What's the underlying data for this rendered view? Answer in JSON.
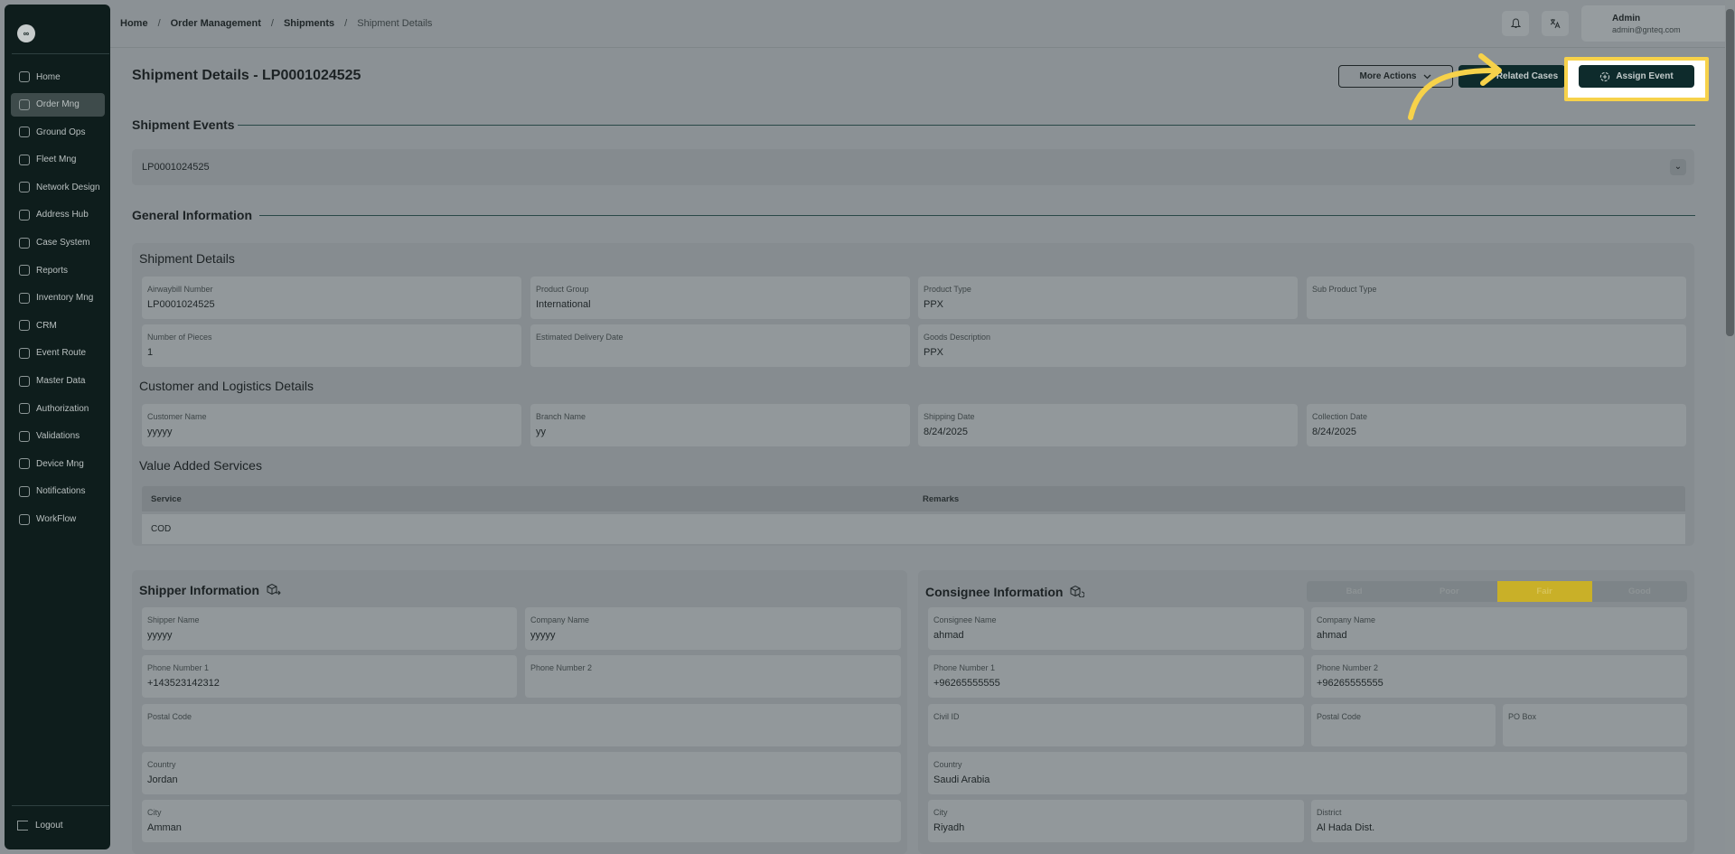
{
  "sidebar": {
    "logo": "∞",
    "items": [
      {
        "label": "Home"
      },
      {
        "label": "Order Mng"
      },
      {
        "label": "Ground Ops"
      },
      {
        "label": "Fleet Mng"
      },
      {
        "label": "Network Design"
      },
      {
        "label": "Address Hub"
      },
      {
        "label": "Case System"
      },
      {
        "label": "Reports"
      },
      {
        "label": "Inventory Mng"
      },
      {
        "label": "CRM"
      },
      {
        "label": "Event Route"
      },
      {
        "label": "Master Data"
      },
      {
        "label": "Authorization"
      },
      {
        "label": "Validations"
      },
      {
        "label": "Device Mng"
      },
      {
        "label": "Notifications"
      },
      {
        "label": "WorkFlow"
      }
    ],
    "active": "Order Mng",
    "logout": "Logout"
  },
  "breadcrumb": {
    "b0": "Home",
    "b1": "Order Management",
    "b2": "Shipments",
    "b3": "Shipment Details",
    "sep": "/"
  },
  "user": {
    "name": "Admin",
    "email": "admin@gnteq.com"
  },
  "header": {
    "title": "Shipment Details - LP0001024525",
    "more_actions": "More Actions",
    "related_cases": "Related Cases",
    "assign_event": "Assign Event",
    "highlight_color": "#f7d24a"
  },
  "events": {
    "title": "Shipment Events",
    "value": "LP0001024525"
  },
  "general": {
    "title": "General Information",
    "shipment_details": {
      "title": "Shipment Details",
      "airwaybill_label": "Airwaybill Number",
      "airwaybill": "LP0001024525",
      "product_group_label": "Product Group",
      "product_group": "International",
      "product_type_label": "Product Type",
      "product_type": "PPX",
      "sub_product_label": "Sub Product Type",
      "sub_product": "",
      "pieces_label": "Number of Pieces",
      "pieces": "1",
      "edd_label": "Estimated Delivery Date",
      "edd": "",
      "goods_label": "Goods Description",
      "goods": "PPX"
    },
    "customer": {
      "title": "Customer and Logistics Details",
      "name_label": "Customer Name",
      "name": "yyyyy",
      "branch_label": "Branch Name",
      "branch": "yy",
      "shipping_label": "Shipping Date",
      "shipping": "8/24/2025",
      "collection_label": "Collection Date",
      "collection": "8/24/2025"
    },
    "vas": {
      "title": "Value Added Services",
      "col_service": "Service",
      "col_remarks": "Remarks",
      "rows": [
        {
          "service": "COD",
          "remarks": ""
        }
      ]
    }
  },
  "shipper": {
    "title": "Shipper Information",
    "name_label": "Shipper Name",
    "name": "yyyyy",
    "company_label": "Company Name",
    "company": "yyyyy",
    "phone1_label": "Phone Number 1",
    "phone1": "+143523142312",
    "phone2_label": "Phone Number 2",
    "phone2": "",
    "postal_label": "Postal Code",
    "postal": "",
    "country_label": "Country",
    "country": "Jordan",
    "city_label": "City",
    "city": "Amman"
  },
  "consignee": {
    "title": "Consignee Information",
    "rating": [
      "Bad",
      "Poor",
      "Fair",
      "Good"
    ],
    "rating_selected": "Fair",
    "name_label": "Consignee Name",
    "name": "ahmad",
    "company_label": "Company Name",
    "company": "ahmad",
    "phone1_label": "Phone Number 1",
    "phone1": "+96265555555",
    "phone2_label": "Phone Number 2",
    "phone2": "+96265555555",
    "civil_label": "Civil ID",
    "civil": "",
    "postal_label": "Postal Code",
    "postal": "",
    "pobox_label": "PO Box",
    "pobox": "",
    "country_label": "Country",
    "country": "Saudi Arabia",
    "city_label": "City",
    "city": "Riyadh",
    "district_label": "District",
    "district": "Al Hada Dist."
  }
}
